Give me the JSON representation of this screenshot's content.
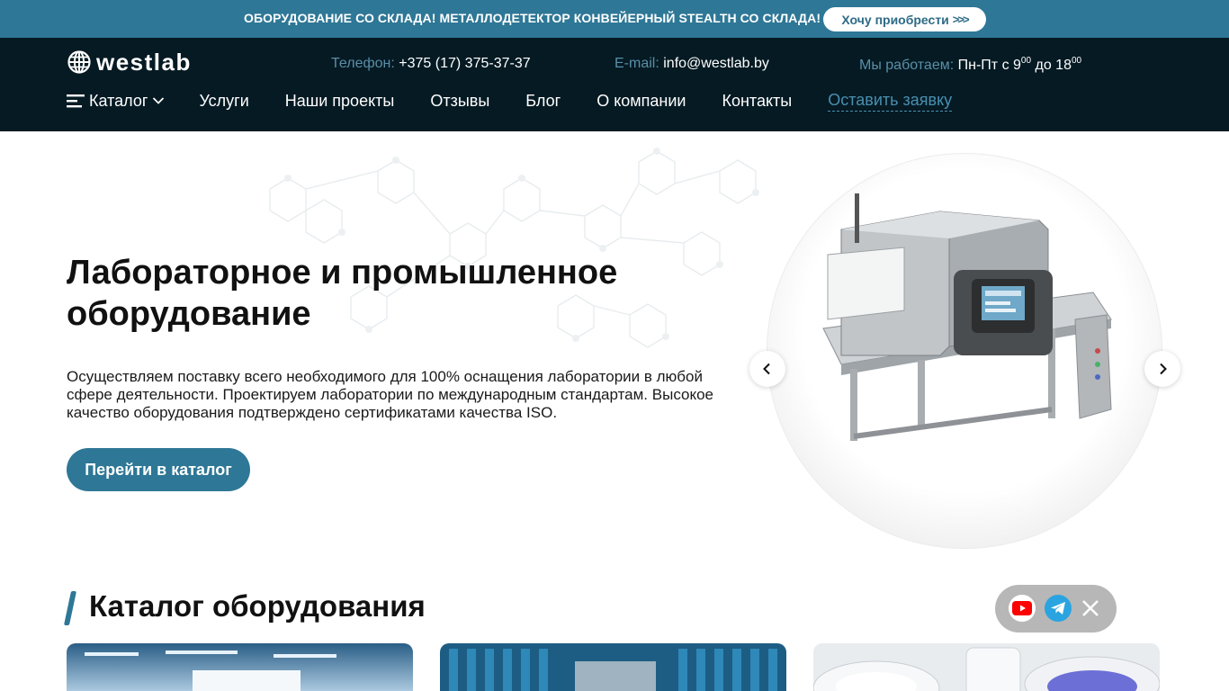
{
  "promo": {
    "text": "ОБОРУДОВАНИЕ СО СКЛАДА! МЕТАЛЛОДЕТЕКТОР КОНВЕЙЕРНЫЙ STEALTH СО СКЛАДА!",
    "button_label": "Хочу приобрести",
    "button_arrows": ">>>"
  },
  "header": {
    "logo_text": "westlab",
    "phone_label": "Телефон:",
    "phone_value": "+375 (17) 375-37-37",
    "email_label": "E-mail:",
    "email_value": "info@westlab.by",
    "hours_label": "Мы работаем:",
    "hours_days": "Пн-Пт с 9",
    "hours_open_sup": "00",
    "hours_to": "до 18",
    "hours_close_sup": "00"
  },
  "nav": {
    "catalog": "Каталог",
    "items": [
      "Услуги",
      "Наши проекты",
      "Отзывы",
      "Блог",
      "О компании",
      "Контакты"
    ],
    "cta": "Оставить заявку"
  },
  "hero": {
    "title": "Лабораторное и промышленное оборудование",
    "description": "Осуществляем поставку всего необходимого для 100% оснащения лаборатории в любой сфере деятельности. Проектируем лаборатории по международным стандартам. Высокое качество оборудования подтверждено сертификатами качества ISO.",
    "button_label": "Перейти в каталог"
  },
  "catalog": {
    "title": "Каталог оборудования"
  },
  "colors": {
    "accent": "#2e7796",
    "header_bg": "#051a23",
    "youtube": "#ff0000",
    "telegram": "#2aa4e0"
  }
}
